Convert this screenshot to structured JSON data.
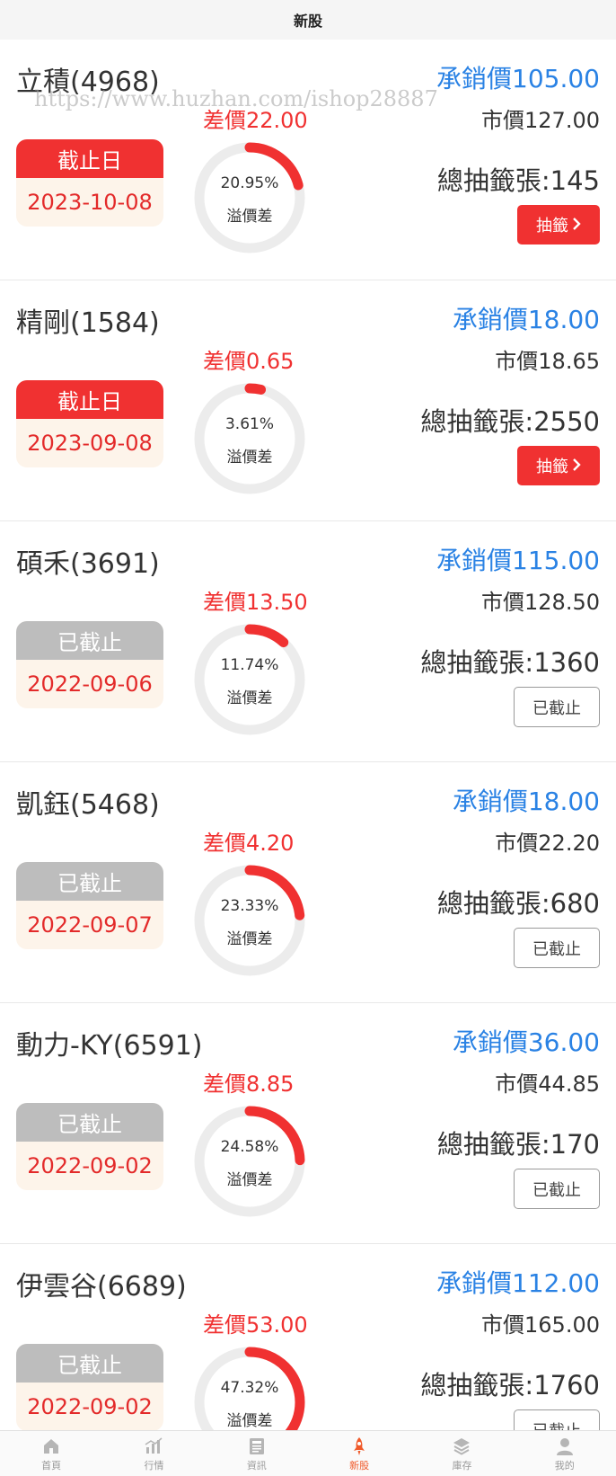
{
  "header": {
    "title": "新股"
  },
  "watermark": "https://www.huzhan.com/ishop28887",
  "stocks": [
    {
      "name": "立積(4968)",
      "underwrite": "承銷價105.00",
      "market": "市價127.00",
      "diff": "差價22.00",
      "status": "截止日",
      "status_type": "active",
      "date": "2023-10-08",
      "percent_text": "20.95%",
      "percent": 20.95,
      "premium_label": "溢價差",
      "total": "總抽籤張:145",
      "action": "抽籤"
    },
    {
      "name": "精剛(1584)",
      "underwrite": "承銷價18.00",
      "market": "市價18.65",
      "diff": "差價0.65",
      "status": "截止日",
      "status_type": "active",
      "date": "2023-09-08",
      "percent_text": "3.61%",
      "percent": 3.61,
      "premium_label": "溢價差",
      "total": "總抽籤張:2550",
      "action": "抽籤"
    },
    {
      "name": "碩禾(3691)",
      "underwrite": "承銷價115.00",
      "market": "市價128.50",
      "diff": "差價13.50",
      "status": "已截止",
      "status_type": "closed",
      "date": "2022-09-06",
      "percent_text": "11.74%",
      "percent": 11.74,
      "premium_label": "溢價差",
      "total": "總抽籤張:1360",
      "action": "已截止"
    },
    {
      "name": "凱鈺(5468)",
      "underwrite": "承銷價18.00",
      "market": "市價22.20",
      "diff": "差價4.20",
      "status": "已截止",
      "status_type": "closed",
      "date": "2022-09-07",
      "percent_text": "23.33%",
      "percent": 23.33,
      "premium_label": "溢價差",
      "total": "總抽籤張:680",
      "action": "已截止"
    },
    {
      "name": "動力-KY(6591)",
      "underwrite": "承銷價36.00",
      "market": "市價44.85",
      "diff": "差價8.85",
      "status": "已截止",
      "status_type": "closed",
      "date": "2022-09-02",
      "percent_text": "24.58%",
      "percent": 24.58,
      "premium_label": "溢價差",
      "total": "總抽籤張:170",
      "action": "已截止"
    },
    {
      "name": "伊雲谷(6689)",
      "underwrite": "承銷價112.00",
      "market": "市價165.00",
      "diff": "差價53.00",
      "status": "已截止",
      "status_type": "closed",
      "date": "2022-09-02",
      "percent_text": "47.32%",
      "percent": 47.32,
      "premium_label": "溢價差",
      "total": "總抽籤張:1760",
      "action": "已截止"
    }
  ],
  "colors": {
    "accent_red": "#f03131",
    "blue": "#2a82e4",
    "ring_track": "#ececec",
    "tab_active": "#f05a2a",
    "tab_inactive": "#b5b5b5"
  },
  "tabbar": [
    {
      "label": "首頁",
      "icon": "home-icon",
      "active": false
    },
    {
      "label": "行情",
      "icon": "chart-icon",
      "active": false
    },
    {
      "label": "資訊",
      "icon": "news-icon",
      "active": false
    },
    {
      "label": "新股",
      "icon": "rocket-icon",
      "active": true
    },
    {
      "label": "庫存",
      "icon": "layers-icon",
      "active": false
    },
    {
      "label": "我的",
      "icon": "user-icon",
      "active": false
    }
  ]
}
